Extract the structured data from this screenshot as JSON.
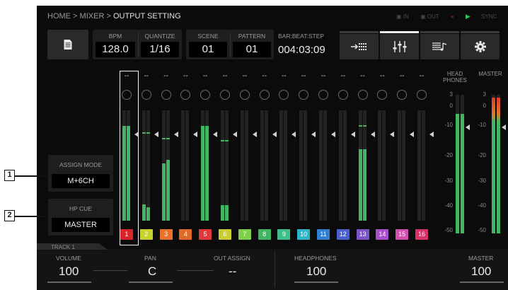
{
  "breadcrumb": {
    "home": "HOME",
    "sep": " > ",
    "mixer": "MIXER",
    "current": "OUTPUT SETTING"
  },
  "status": {
    "midi_in": "IN",
    "midi_out": "OUT",
    "play": "▶",
    "sync": "SYNC",
    "record_dot": "●"
  },
  "header": {
    "bpm": {
      "label": "BPM",
      "value": "128.0"
    },
    "quantize": {
      "label": "QUANTIZE",
      "value": "1/16"
    },
    "scene": {
      "label": "SCENE",
      "value": "01"
    },
    "pattern": {
      "label": "PATTERN",
      "value": "01"
    },
    "position": {
      "label": "BAR:BEAT:STEP",
      "value": "004:03:09"
    }
  },
  "tabs": [
    {
      "icon": "sequencer-icon",
      "active": false
    },
    {
      "icon": "mixer-icon",
      "active": true
    },
    {
      "icon": "instrument-icon",
      "active": false
    },
    {
      "icon": "gear-icon",
      "active": false
    }
  ],
  "channels": [
    {
      "num": "1",
      "color": "#d9262c",
      "level": 0.86,
      "level2": 0.86,
      "peak": null,
      "sel": true
    },
    {
      "num": "2",
      "color": "#c7d32c",
      "level": 0.15,
      "level2": 0.12,
      "peak": 0.79
    },
    {
      "num": "3",
      "color": "#e8722a",
      "level": 0.52,
      "level2": 0.55,
      "peak": 0.74
    },
    {
      "num": "4",
      "color": "#e06a2a",
      "level": 0,
      "level2": 0,
      "peak": null
    },
    {
      "num": "5",
      "color": "#e03a3a",
      "level": 0.86,
      "level2": 0.86,
      "peak": null
    },
    {
      "num": "6",
      "color": "#c8cf35",
      "level": 0.14,
      "level2": 0.14,
      "peak": 0.72
    },
    {
      "num": "7",
      "color": "#7fcf4a",
      "level": 0,
      "level2": 0,
      "peak": null
    },
    {
      "num": "8",
      "color": "#41b561",
      "level": 0,
      "level2": 0,
      "peak": null
    },
    {
      "num": "9",
      "color": "#3fbf8a",
      "level": 0,
      "level2": 0,
      "peak": null
    },
    {
      "num": "10",
      "color": "#2fb5c8",
      "level": 0,
      "level2": 0,
      "peak": null
    },
    {
      "num": "11",
      "color": "#2f7fd4",
      "level": 0,
      "level2": 0,
      "peak": null
    },
    {
      "num": "12",
      "color": "#4a5fd0",
      "level": 0,
      "level2": 0,
      "peak": null
    },
    {
      "num": "13",
      "color": "#7a54c8",
      "level": 0.65,
      "level2": 0.65,
      "peak": 0.85
    },
    {
      "num": "14",
      "color": "#a64fc8",
      "level": 0,
      "level2": 0,
      "peak": null
    },
    {
      "num": "15",
      "color": "#d04fb0",
      "level": 0,
      "level2": 0,
      "peak": null
    },
    {
      "num": "16",
      "color": "#d8326a",
      "level": 0,
      "level2": 0,
      "peak": null
    }
  ],
  "channel_dash": "--",
  "meters": {
    "headphones_label": "HEAD PHONES",
    "master_label": "MASTER",
    "scale": [
      "3",
      "0",
      "-10",
      "-20",
      "-30",
      "-40",
      "-50"
    ],
    "headphones_level": 0.86,
    "master_level": 0.98
  },
  "assign_mode": {
    "label": "ASSIGN MODE",
    "value": "M+6CH"
  },
  "hp_cue": {
    "label": "HP CUE",
    "value": "MASTER"
  },
  "callouts": {
    "one": "1",
    "two": "2"
  },
  "bottom": {
    "track": "TRACK 1",
    "volume": {
      "label": "VOLUME",
      "value": "100"
    },
    "pan": {
      "label": "PAN",
      "value": "C"
    },
    "out_assign": {
      "label": "OUT ASSIGN",
      "value": "--"
    },
    "headphones": {
      "label": "HEADPHONES",
      "value": "100"
    },
    "master": {
      "label": "MASTER",
      "value": "100"
    }
  }
}
